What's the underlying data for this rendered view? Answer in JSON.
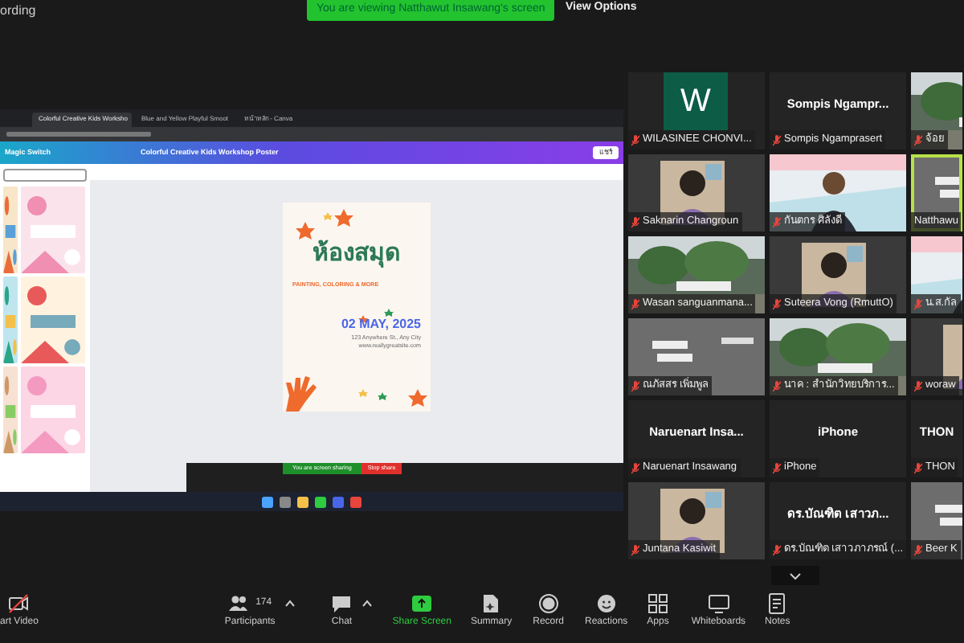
{
  "top_bar": {
    "recording": "ording",
    "banner": "You are viewing Natthawut Insawang's screen",
    "view_options": "View Options"
  },
  "shared_screen": {
    "browser_tabs": [
      {
        "label": "Colorful Creative Kids Worksho",
        "selected": true
      },
      {
        "label": "Blue and Yellow Playful Smoot",
        "selected": false
      },
      {
        "label": "หน้าหลัก - Canva",
        "selected": false
      }
    ],
    "magic_switch": "Magic Switch",
    "design_title": "Colorful Creative Kids Workshop Poster",
    "share_button": "แชร์",
    "poster": {
      "title": "ห้องสมุด",
      "subtitle": "PAINTING, COLORING & MORE",
      "date": "02 MAY, 2025",
      "address": "123 Anywhere St., Any City",
      "website": "www.reallygreatsite.com"
    },
    "sharing_banner": "You are screen sharing",
    "stop_share": "Stop share"
  },
  "gallery": [
    {
      "kind": "avatar",
      "letter": "W",
      "label": "WILASINEE CHONVI...",
      "muted": true,
      "speaking": false
    },
    {
      "kind": "name",
      "display_name": "Sompis  Ngampr...",
      "label": "Sompis Ngamprasert",
      "muted": true,
      "speaking": false
    },
    {
      "kind": "picture",
      "label": "จ้อย",
      "muted": true,
      "speaking": false
    },
    {
      "kind": "picture",
      "label": "Saknarin Changroun",
      "muted": true,
      "speaking": false
    },
    {
      "kind": "picture",
      "label": "กันตกร ศิลังดี",
      "muted": true,
      "speaking": false
    },
    {
      "kind": "picture",
      "label": "Natthawu",
      "muted": false,
      "speaking": true
    },
    {
      "kind": "picture",
      "label": "Wasan sanguanmana...",
      "muted": true,
      "speaking": false
    },
    {
      "kind": "picture",
      "label": "Suteera Vong (RmuttO)",
      "muted": true,
      "speaking": false
    },
    {
      "kind": "picture",
      "label": "น.ส.กัล",
      "muted": true,
      "speaking": false
    },
    {
      "kind": "picture",
      "label": "ณภัสสร เพิ่มพูล",
      "muted": true,
      "speaking": false
    },
    {
      "kind": "picture",
      "label": "นาค : สำนักวิทยบริการ...",
      "muted": true,
      "speaking": false
    },
    {
      "kind": "picture",
      "label": "woraw",
      "muted": true,
      "speaking": false
    },
    {
      "kind": "name",
      "display_name": "Naruenart  Insa...",
      "label": "Naruenart Insawang",
      "muted": true,
      "speaking": false
    },
    {
      "kind": "name",
      "display_name": "iPhone",
      "label": "iPhone",
      "muted": true,
      "speaking": false
    },
    {
      "kind": "name",
      "display_name": "THON",
      "label": "THON",
      "muted": true,
      "speaking": false
    },
    {
      "kind": "picture",
      "label": "Juntana Kasiwit",
      "muted": true,
      "speaking": false
    },
    {
      "kind": "name",
      "display_name": "ดร.บัณฑิต เสาวภ...",
      "label": "ดร.บัณฑิต เสาวภาภรณ์ (...",
      "muted": true,
      "speaking": false
    },
    {
      "kind": "picture",
      "label": "Beer K",
      "muted": true,
      "speaking": false
    }
  ],
  "toolbar": [
    {
      "kind": "video-off",
      "label": "art Video",
      "highlighted": false,
      "caret": false
    },
    {
      "kind": "participants",
      "label": "Participants",
      "count": "174",
      "highlighted": false,
      "caret": true
    },
    {
      "kind": "chat",
      "label": "Chat",
      "highlighted": false,
      "caret": true
    },
    {
      "kind": "share",
      "label": "Share Screen",
      "highlighted": true,
      "caret": false
    },
    {
      "kind": "summary",
      "label": "Summary",
      "highlighted": false,
      "caret": false
    },
    {
      "kind": "record",
      "label": "Record",
      "highlighted": false,
      "caret": false
    },
    {
      "kind": "reactions",
      "label": "Reactions",
      "highlighted": false,
      "caret": false
    },
    {
      "kind": "apps",
      "label": "Apps",
      "highlighted": false,
      "caret": false
    },
    {
      "kind": "whiteboards",
      "label": "Whiteboards",
      "highlighted": false,
      "caret": false
    },
    {
      "kind": "notes",
      "label": "Notes",
      "highlighted": false,
      "caret": false
    }
  ]
}
